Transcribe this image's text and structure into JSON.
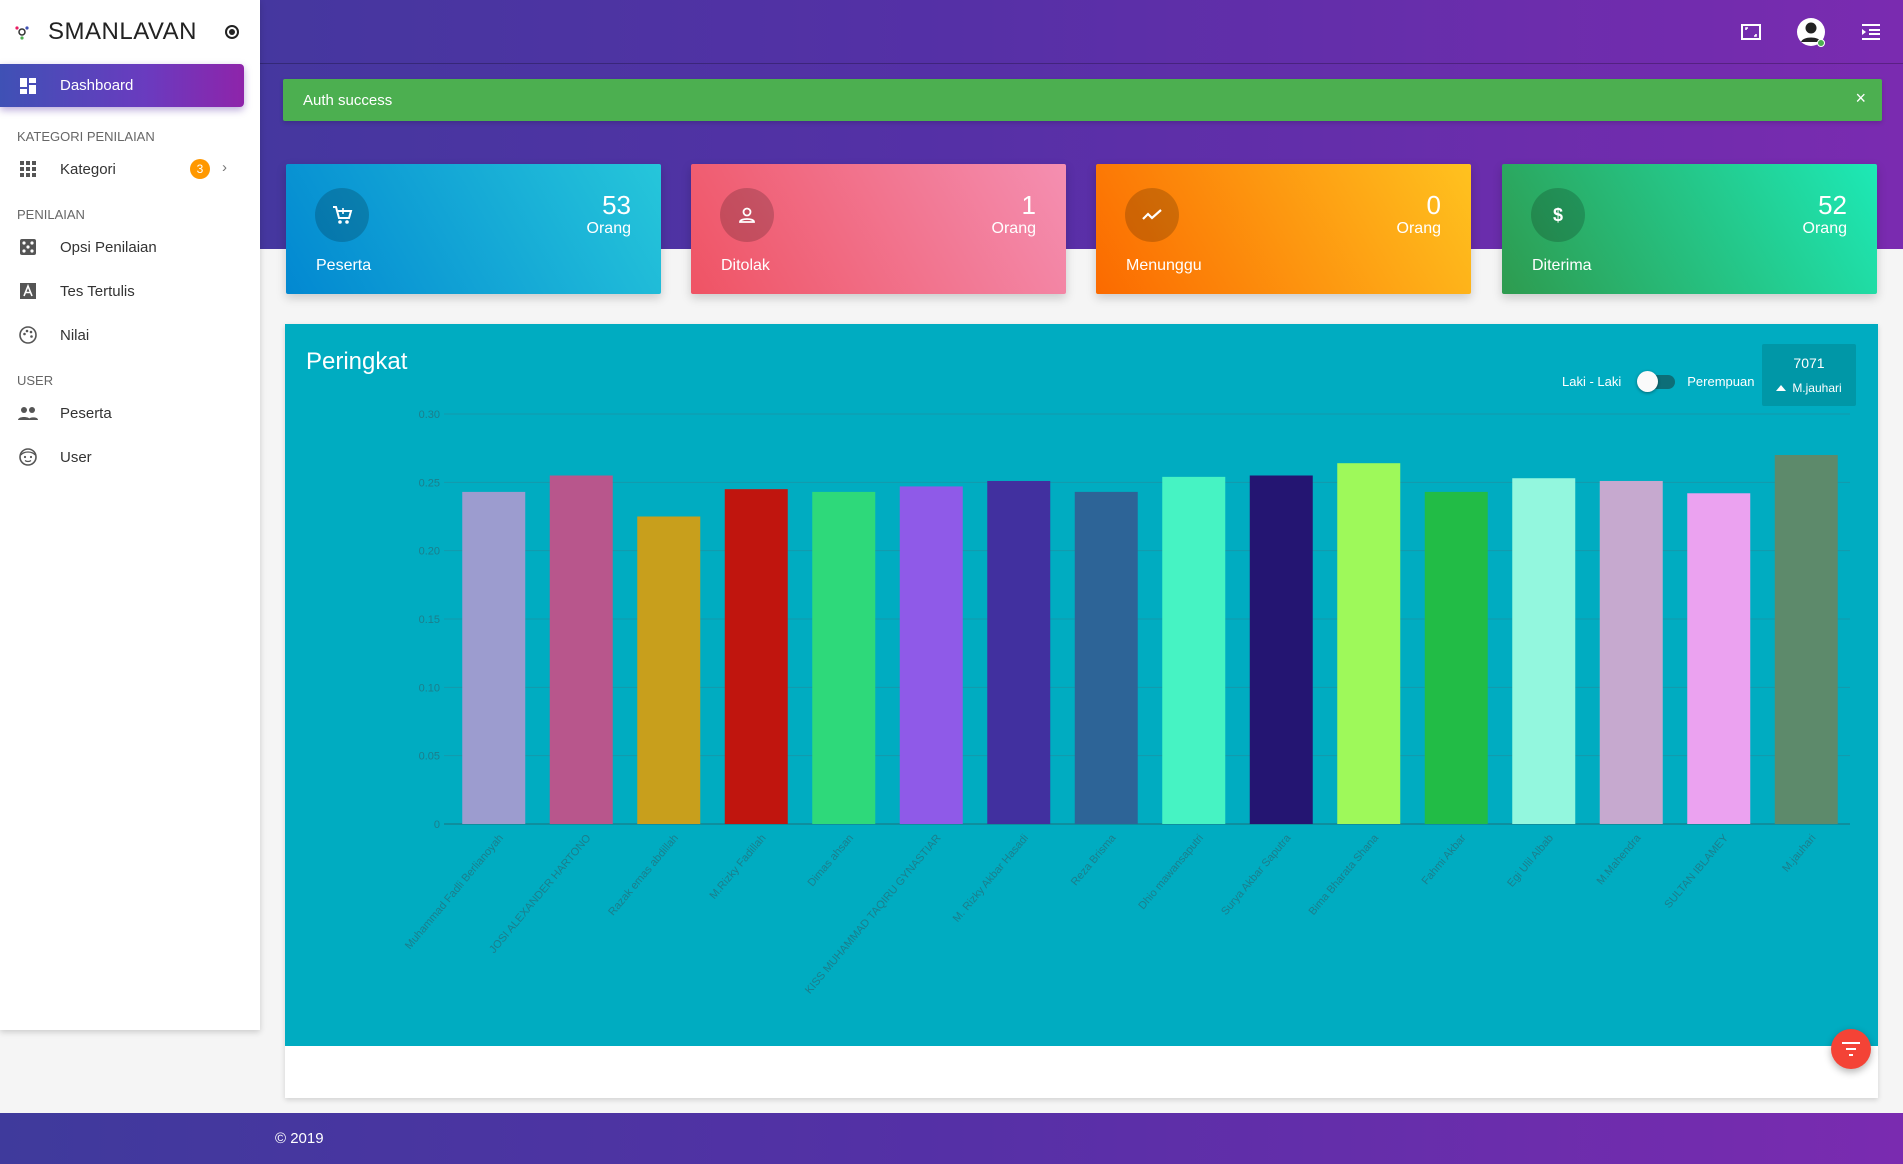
{
  "app": {
    "name": "SMANLAVAN"
  },
  "sidebar": {
    "active": {
      "label": "Dashboard",
      "icon": "dashboard-icon"
    },
    "sections": [
      {
        "title": "KATEGORI PENILAIAN",
        "items": [
          {
            "label": "Kategori",
            "icon": "apps-icon",
            "badge": "3"
          }
        ]
      },
      {
        "title": "PENILAIAN",
        "items": [
          {
            "label": "Opsi Penilaian",
            "icon": "dice-icon"
          },
          {
            "label": "Tes Tertulis",
            "icon": "text-icon"
          },
          {
            "label": "Nilai",
            "icon": "palette-icon"
          }
        ]
      },
      {
        "title": "USER",
        "items": [
          {
            "label": "Peserta",
            "icon": "people-icon"
          },
          {
            "label": "User",
            "icon": "face-icon"
          }
        ]
      }
    ]
  },
  "alert": {
    "text": "Auth success",
    "close": "×"
  },
  "cards": [
    {
      "label": "Peserta",
      "value": "53",
      "unit": "Orang",
      "icon": "cart-icon",
      "color": "#00bcd4"
    },
    {
      "label": "Ditolak",
      "value": "1",
      "unit": "Orang",
      "icon": "person-icon",
      "color": "#f55a6e"
    },
    {
      "label": "Menunggu",
      "value": "0",
      "unit": "Orang",
      "icon": "trend-icon",
      "color": "#ff9800"
    },
    {
      "label": "Diterima",
      "value": "52",
      "unit": "Orang",
      "icon": "dollar-icon",
      "color": "#26c281"
    }
  ],
  "chart_panel": {
    "title": "Peringkat",
    "toggle": {
      "left": "Laki - Laki",
      "right": "Perempuan"
    },
    "top": {
      "value": "7071",
      "name": "M.jauhari"
    }
  },
  "chart_data": {
    "type": "bar",
    "title": "Peringkat",
    "ylim": [
      0,
      0.3
    ],
    "yticks": [
      "0",
      "0.05",
      "0.10",
      "0.15",
      "0.20",
      "0.25",
      "0.30"
    ],
    "grid": true,
    "categories": [
      "Muhammad Fadli Berlianoyah",
      "JOSI ALEXANDER HARTONO",
      "Razak emas abdillah",
      "M.Rizky Fadillah",
      "Dimas ahsan",
      "KISS MUHAMMAD TAQIRU GYNASTIAR",
      "M. Rizky Akbar Hasadi",
      "Reza Brisma",
      "Dhio mawansaputri",
      "Surya Akbar Saputra",
      "Bima Bharata Shana",
      "Fahmi Akbar",
      "Egi Ulil Albab",
      "M.Mahendra",
      "SULTAN IBLAMEY",
      "M.jauhari"
    ],
    "values": [
      0.243,
      0.255,
      0.225,
      0.245,
      0.243,
      0.247,
      0.251,
      0.243,
      0.254,
      0.255,
      0.264,
      0.243,
      0.253,
      0.251,
      0.242,
      0.27
    ],
    "colors": [
      "#9c9ccf",
      "#b8568c",
      "#c89f1c",
      "#c0150e",
      "#2ed97a",
      "#8f5ae8",
      "#41309f",
      "#2d6497",
      "#46f3c3",
      "#241572",
      "#9ef95a",
      "#22bc46",
      "#93f7de",
      "#c6a9cf",
      "#eba2f0",
      "#5d8a6b"
    ]
  },
  "footer": {
    "text": "© 2019"
  },
  "colors": {
    "accent_start": "#3f3a9c",
    "accent_end": "#7a2bb0",
    "alert": "#4caf50",
    "chart_bg": "#00acc1",
    "fab": "#f44336"
  }
}
